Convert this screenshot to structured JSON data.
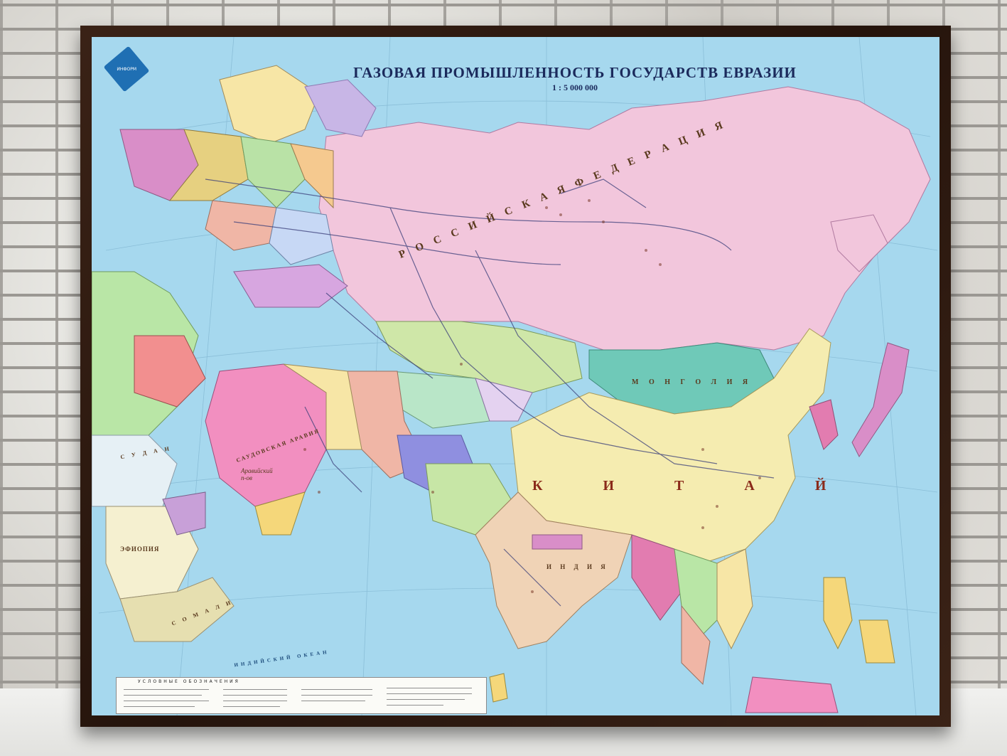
{
  "map": {
    "title": "ГАЗОВАЯ ПРОМЫШЛЕННОСТЬ ГОСУДАРСТВ ЕВРАЗИИ",
    "scale": "1 : 5 000 000",
    "labels": {
      "russia": "Р О С С И Й С К А Я   Ф Е Д Е Р А Ц И Я",
      "china": "К И Т А Й",
      "mongolia": "М О Н Г О Л И Я",
      "arabian_peninsula": "Аравийский п-ов",
      "saudi_arabia": "САУДОВСКАЯ АРАВИЯ",
      "ethiopia": "ЭФИОПИЯ",
      "sudan": "С У Д А Н",
      "india": "И Н Д И Я",
      "indian_ocean": "ИНДИЙСКИЙ ОКЕАН",
      "somalia": "С О М А Л И"
    },
    "legend": {
      "title": "УСЛОВНЫЕ   ОБОЗНАЧЕНИЯ"
    },
    "colors": {
      "sea": "#a6d8ee",
      "russia": "#f2c6dc",
      "china": "#f5ecb0",
      "mongolia": "#6fc9b8",
      "kazakhstan": "#cfe7a8",
      "india": "#f0d3b6",
      "saudi": "#f28fc0",
      "frame": "#2f1a10"
    }
  }
}
